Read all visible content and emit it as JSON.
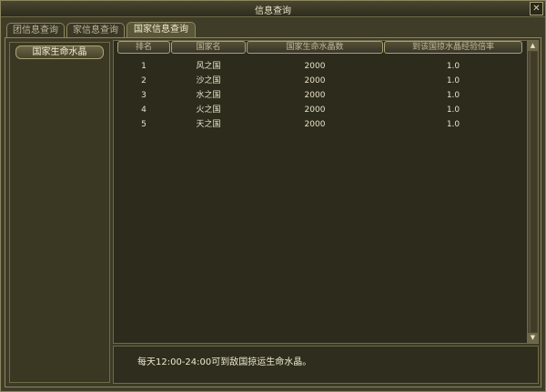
{
  "window": {
    "title": "信息查询",
    "close_glyph": "✕"
  },
  "tabs": [
    {
      "label": "团信息查询",
      "active": false
    },
    {
      "label": "家信息查询",
      "active": false
    },
    {
      "label": "国家信息查询",
      "active": true
    }
  ],
  "sidebar": {
    "button_label": "国家生命水晶"
  },
  "table": {
    "headers": [
      "排名",
      "国家名",
      "国家生命水晶数",
      "到该国掠水晶经验倍率"
    ],
    "rows": [
      {
        "rank": "1",
        "name": "风之国",
        "crystals": "2000",
        "rate": "1.0"
      },
      {
        "rank": "2",
        "name": "沙之国",
        "crystals": "2000",
        "rate": "1.0"
      },
      {
        "rank": "3",
        "name": "水之国",
        "crystals": "2000",
        "rate": "1.0"
      },
      {
        "rank": "4",
        "name": "火之国",
        "crystals": "2000",
        "rate": "1.0"
      },
      {
        "rank": "5",
        "name": "天之国",
        "crystals": "2000",
        "rate": "1.0"
      }
    ]
  },
  "scrollbar": {
    "up_glyph": "▲",
    "down_glyph": "▼"
  },
  "footer": {
    "info_text": "每天12:00-24:00可到敌国掠运生命水晶。"
  }
}
